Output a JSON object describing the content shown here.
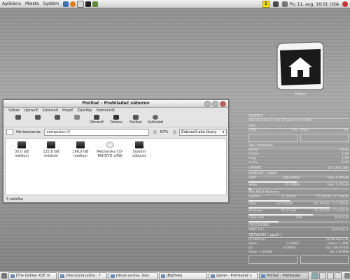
{
  "top_panel": {
    "menus": [
      "Aplikácie",
      "Miesta",
      "Systém"
    ],
    "launcher_icons": [
      "network-icon",
      "firefox-icon",
      "mail-icon",
      "terminal-icon",
      "editor-icon"
    ],
    "update_badge": "1",
    "clock": "Po, 11. aug, 16:01",
    "locale": "USA"
  },
  "desktop": {
    "home_icon_label": "Home"
  },
  "file_manager": {
    "title": "Počítač - Prehliadač súborov",
    "menus": [
      "Súbor",
      "Upraviť",
      "Zobraziť",
      "Prejsť",
      "Záložky",
      "Pomocník"
    ],
    "toolbar": [
      {
        "label": "Späť",
        "icon": "back-icon"
      },
      {
        "label": "Dopredu",
        "icon": "forward-icon"
      },
      {
        "label": "Vyššie",
        "icon": "up-icon"
      },
      {
        "label": "Zastaviť",
        "icon": "stop-icon"
      },
      {
        "label": "Obnoviť",
        "icon": "reload-icon"
      },
      {
        "label": "Domov",
        "icon": "home-icon"
      },
      {
        "label": "Počítač",
        "icon": "computer-icon"
      },
      {
        "label": "Vyhľadať",
        "icon": "search-icon"
      }
    ],
    "location_label": "Umiestnenie:",
    "location_value": "computer:///",
    "zoom": "67%",
    "view_mode": "Zobraziť ako ikony",
    "items": [
      {
        "label": "35,0 GB médium",
        "icon": "harddisk-icon"
      },
      {
        "label": "125,8 GB médium",
        "icon": "harddisk-icon"
      },
      {
        "label": "166,9 GB médium",
        "icon": "harddisk-icon"
      },
      {
        "label": "Mechanika CD-RW/DVD ±RW",
        "icon": "optical-drive-icon"
      },
      {
        "label": "Systém súborov",
        "icon": "filesystem-icon"
      }
    ],
    "status": "5 položka"
  },
  "conky": {
    "system_title": "SYSTEM",
    "kernel": "Ubuntu Linux 2.6.24-20-generic on i686",
    "cpu_label": "CPU",
    "cpu1": {
      "label": "CPU1",
      "value": "3%"
    },
    "cpu2": {
      "label": "CPU2",
      "value": "5%"
    },
    "top_title": "Top Processes",
    "top_head": {
      "name": "Name",
      "cpu": "CPU%"
    },
    "processes": [
      {
        "name": "firefox",
        "cpu": "2.96"
      },
      {
        "name": "Xorg",
        "cpu": "1.98"
      },
      {
        "name": "conky",
        "cpu": "0.49"
      }
    ],
    "uptime_label": "UPTIME",
    "uptime": "1h 15m 38s",
    "mem_title": "MEMORY / SWAP",
    "ram": {
      "label": "RAM",
      "used": "488.86MiB",
      "max": "max: 0.99GiB",
      "frac": 0.48
    },
    "swap": {
      "label": "Swap",
      "used": "20.03MiB",
      "max": "max: 5.72GiB",
      "frac": 0.03
    },
    "hd_title": "HD/ HDD Memory",
    "disks": [
      {
        "label": "System",
        "used": "11.25GiB",
        "max": "15.01GiB / 27.59GiB",
        "frac": 0.41
      },
      {
        "label": "Data",
        "used": "135.55GiB",
        "max": "167.69GiB / 115.36GiB",
        "frac": 0.81
      },
      {
        "label": "Windows",
        "used": "63.17GiB",
        "max": "93.04GiB / 172.82GiB",
        "frac": 0.64
      },
      {
        "label": "Hibernate",
        "used": "30%",
        "max": "38.01GiB",
        "frac": 0.3
      }
    ],
    "processes_title": "PROCESSES",
    "proc_row": {
      "total": "Total: 137",
      "running": "Running: 1"
    },
    "network_title": "NETWORK ( ppp0 )",
    "ip": {
      "label": "IP address",
      "value": "78.98.160.231"
    },
    "down": {
      "label": "Down",
      "value": "0.00KiB",
      "speed": "Down: 1.3MB"
    },
    "up": {
      "label": "Up",
      "value": "0.00KiB",
      "speed": "Up: 134.47KiB"
    },
    "down_total": {
      "label": "Down: 1.20GiB"
    },
    "up_total": {
      "label": "Up: 1.87MiB"
    }
  },
  "taskbar": {
    "tasks": [
      {
        "label": "[The Debian KDE m",
        "active": false
      },
      {
        "label": "[Doručená pošta - T",
        "active": false
      },
      {
        "label": "[Nová správa: (bez",
        "active": false
      },
      {
        "label": "[BigFree]",
        "active": false
      },
      {
        "label": "[peter - Prehliadač s",
        "active": false
      },
      {
        "label": "Počítač - Prehliadač",
        "active": true
      }
    ],
    "workspaces": 4
  },
  "colors": {
    "conky_text": "#eaeaea",
    "warn_badge": "#f6e600",
    "link_blue": "#6a8ab8"
  }
}
